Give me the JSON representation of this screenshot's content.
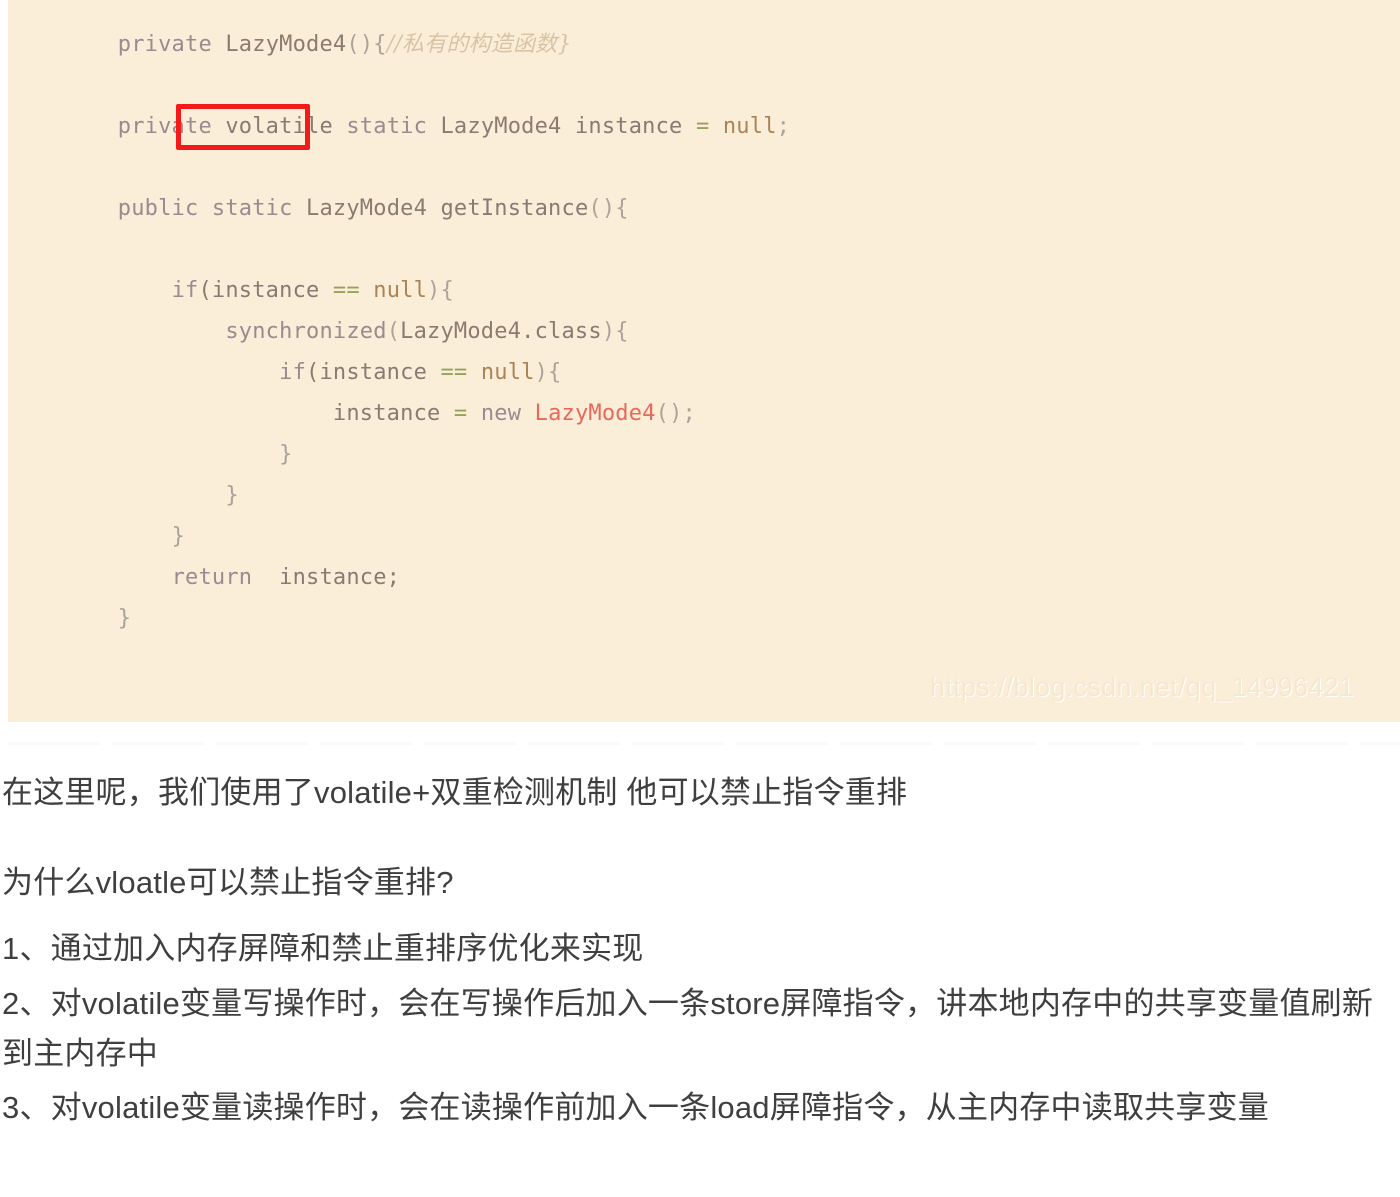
{
  "code_block": {
    "language": "java",
    "background_color": "#fbeed9",
    "highlight_box_color": "#f41a1a",
    "highlighted_token": "volatile",
    "watermark": "https://blog.csdn.net/qq_14996421",
    "lines": [
      {
        "indent": 0,
        "segments": [
          {
            "t": "    ",
            "c": "plain"
          },
          {
            "t": "private",
            "c": "kw"
          },
          {
            "t": " ",
            "c": "plain"
          },
          {
            "t": "LazyMode4",
            "c": "type"
          },
          {
            "t": "(){",
            "c": "punct"
          },
          {
            "t": "//私有的构造函数}",
            "c": "comment"
          }
        ]
      },
      {
        "indent": 0,
        "segments": []
      },
      {
        "indent": 0,
        "segments": [
          {
            "t": "    ",
            "c": "plain"
          },
          {
            "t": "private",
            "c": "kw"
          },
          {
            "t": " volatile ",
            "c": "plain"
          },
          {
            "t": "static",
            "c": "kw"
          },
          {
            "t": " ",
            "c": "plain"
          },
          {
            "t": "LazyMode4",
            "c": "type"
          },
          {
            "t": " instance ",
            "c": "plain"
          },
          {
            "t": "=",
            "c": "op-eq"
          },
          {
            "t": " ",
            "c": "plain"
          },
          {
            "t": "null",
            "c": "nullv"
          },
          {
            "t": ";",
            "c": "punct"
          }
        ]
      },
      {
        "indent": 0,
        "segments": []
      },
      {
        "indent": 0,
        "segments": [
          {
            "t": "    ",
            "c": "plain"
          },
          {
            "t": "public",
            "c": "kw"
          },
          {
            "t": " ",
            "c": "plain"
          },
          {
            "t": "static",
            "c": "kw"
          },
          {
            "t": " ",
            "c": "plain"
          },
          {
            "t": "LazyMode4",
            "c": "type"
          },
          {
            "t": " getInstance",
            "c": "plain"
          },
          {
            "t": "(){",
            "c": "punct"
          }
        ]
      },
      {
        "indent": 0,
        "segments": []
      },
      {
        "indent": 0,
        "segments": [
          {
            "t": "        ",
            "c": "plain"
          },
          {
            "t": "if",
            "c": "kw"
          },
          {
            "t": "(instance ",
            "c": "plain"
          },
          {
            "t": "==",
            "c": "op-eq"
          },
          {
            "t": " ",
            "c": "plain"
          },
          {
            "t": "null",
            "c": "nullv"
          },
          {
            "t": "){",
            "c": "punct"
          }
        ]
      },
      {
        "indent": 0,
        "segments": [
          {
            "t": "            ",
            "c": "plain"
          },
          {
            "t": "synchronized",
            "c": "kw"
          },
          {
            "t": "(",
            "c": "punct"
          },
          {
            "t": "LazyMode4",
            "c": "type"
          },
          {
            "t": ".class",
            "c": "plain"
          },
          {
            "t": "){",
            "c": "punct"
          }
        ]
      },
      {
        "indent": 0,
        "segments": [
          {
            "t": "                ",
            "c": "plain"
          },
          {
            "t": "if",
            "c": "kw"
          },
          {
            "t": "(instance ",
            "c": "plain"
          },
          {
            "t": "==",
            "c": "op-eq"
          },
          {
            "t": " ",
            "c": "plain"
          },
          {
            "t": "null",
            "c": "nullv"
          },
          {
            "t": "){",
            "c": "punct"
          }
        ]
      },
      {
        "indent": 0,
        "segments": [
          {
            "t": "                    ",
            "c": "plain"
          },
          {
            "t": "instance ",
            "c": "plain"
          },
          {
            "t": "=",
            "c": "op-eq"
          },
          {
            "t": " ",
            "c": "plain"
          },
          {
            "t": "new",
            "c": "kw"
          },
          {
            "t": " ",
            "c": "plain"
          },
          {
            "t": "LazyMode4",
            "c": "cls-red"
          },
          {
            "t": "();",
            "c": "punct"
          }
        ]
      },
      {
        "indent": 0,
        "segments": [
          {
            "t": "                ",
            "c": "plain"
          },
          {
            "t": "}",
            "c": "brace"
          }
        ]
      },
      {
        "indent": 0,
        "segments": [
          {
            "t": "            ",
            "c": "plain"
          },
          {
            "t": "}",
            "c": "brace"
          }
        ]
      },
      {
        "indent": 0,
        "segments": [
          {
            "t": "        ",
            "c": "plain"
          },
          {
            "t": "}",
            "c": "brace"
          }
        ]
      },
      {
        "indent": 0,
        "segments": [
          {
            "t": "        ",
            "c": "plain"
          },
          {
            "t": "return",
            "c": "kw"
          },
          {
            "t": "  instance;",
            "c": "plain"
          }
        ]
      },
      {
        "indent": 0,
        "segments": [
          {
            "t": "    ",
            "c": "plain"
          },
          {
            "t": "}",
            "c": "brace"
          }
        ]
      },
      {
        "indent": 0,
        "segments": []
      },
      {
        "indent": 0,
        "segments": []
      },
      {
        "indent": 0,
        "segments": [
          {
            "t": "}",
            "c": "brace"
          }
        ]
      }
    ]
  },
  "prose": {
    "lead": "在这里呢，我们使用了volatile+双重检测机制 他可以禁止指令重排",
    "question": "为什么vloatle可以禁止指令重排?",
    "items": [
      "1、通过加入内存屏障和禁止重排序优化来实现",
      "2、对volatile变量写操作时，会在写操作后加入一条store屏障指令，讲本地内存中的共享变量值刷新到主内存中",
      "3、对volatile变量读操作时，会在读操作前加入一条load屏障指令，从主内存中读取共享变量"
    ]
  }
}
